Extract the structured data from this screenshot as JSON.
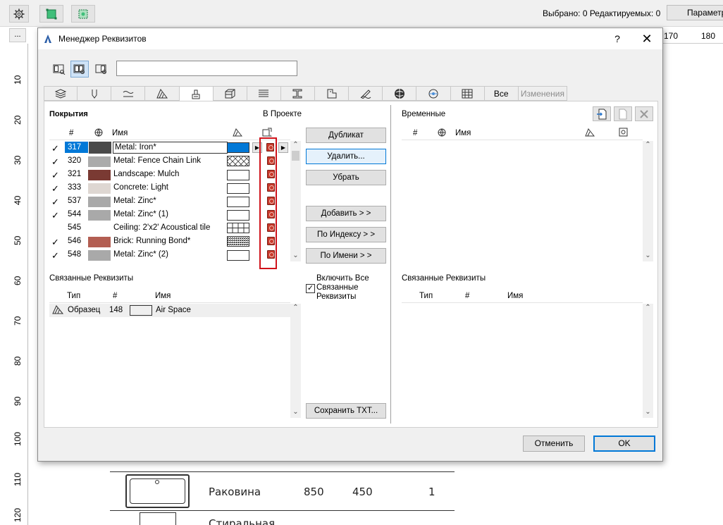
{
  "app": {
    "status": "Выбрано: 0  Редактируемых: 0",
    "params_label": "Параметры",
    "small_btn": "...",
    "ruler_top": [
      "170",
      "180"
    ],
    "ruler_left": [
      "10",
      "20",
      "30",
      "40",
      "50",
      "60",
      "70",
      "80",
      "90",
      "100",
      "110",
      "120"
    ],
    "drawing": {
      "item1_name": "Раковина",
      "item1_w": "850",
      "item1_h": "450",
      "item1_qty": "1",
      "item2_name": "Стиральная"
    }
  },
  "dialog": {
    "title": "Менеджер Реквизитов",
    "help": "?",
    "close": "✕",
    "search_value": "",
    "tabs_text": [
      "Все",
      "Изменения"
    ],
    "left": {
      "section_title": "Покрытия",
      "in_project_label": "В Проекте",
      "columns": {
        "num": "#",
        "name": "Имя"
      },
      "rows": [
        {
          "idx": "317",
          "name": "Metal: Iron*",
          "swatch": "#4a4a4a",
          "fill": "#0078d7",
          "checked": "✓",
          "selected": true
        },
        {
          "idx": "320",
          "name": "Metal: Fence Chain Link",
          "swatch": "#ababab",
          "fill": "hatch-cross",
          "checked": "✓"
        },
        {
          "idx": "321",
          "name": "Landscape: Mulch",
          "swatch": "#7a3a33",
          "fill": "white",
          "checked": "✓"
        },
        {
          "idx": "333",
          "name": "Concrete: Light",
          "swatch": "#ded7d2",
          "fill": "white",
          "checked": "✓"
        },
        {
          "idx": "537",
          "name": "Metal: Zinc*",
          "swatch": "#a9a9a9",
          "fill": "white",
          "checked": "✓"
        },
        {
          "idx": "544",
          "name": "Metal: Zinc* (1)",
          "swatch": "#a9a9a9",
          "fill": "white",
          "checked": "✓"
        },
        {
          "idx": "545",
          "name": "Ceiling: 2'x2' Acoustical tile",
          "swatch": "#ffffff",
          "fill": "grid",
          "checked": ""
        },
        {
          "idx": "546",
          "name": "Brick: Running Bond*",
          "swatch": "#b35e52",
          "fill": "dense",
          "checked": "✓"
        },
        {
          "idx": "548",
          "name": "Metal: Zinc* (2)",
          "swatch": "#a9a9a9",
          "fill": "white",
          "checked": "✓"
        }
      ],
      "linked_title": "Связанные Реквизиты",
      "linked_columns": {
        "type": "Тип",
        "num": "#",
        "name": "Имя"
      },
      "linked_rows": [
        {
          "type": "Образец",
          "num": "148",
          "name": "Air Space"
        }
      ]
    },
    "buttons": {
      "duplicate": "Дубликат",
      "delete": "Удалить...",
      "remove": "Убрать",
      "add": "Добавить > >",
      "by_index": "По Индексу > >",
      "by_name": "По Имени > >",
      "save_txt": "Сохранить TXT...",
      "include_linked": "Включить Все Связанные Реквизиты",
      "include_checked": "✓"
    },
    "right": {
      "section_title": "Временные",
      "columns": {
        "num": "#",
        "name": "Имя"
      },
      "linked_title": "Связанные Реквизиты",
      "linked_columns": {
        "type": "Тип",
        "num": "#",
        "name": "Имя"
      }
    },
    "footer": {
      "cancel": "Отменить",
      "ok": "OK"
    }
  }
}
